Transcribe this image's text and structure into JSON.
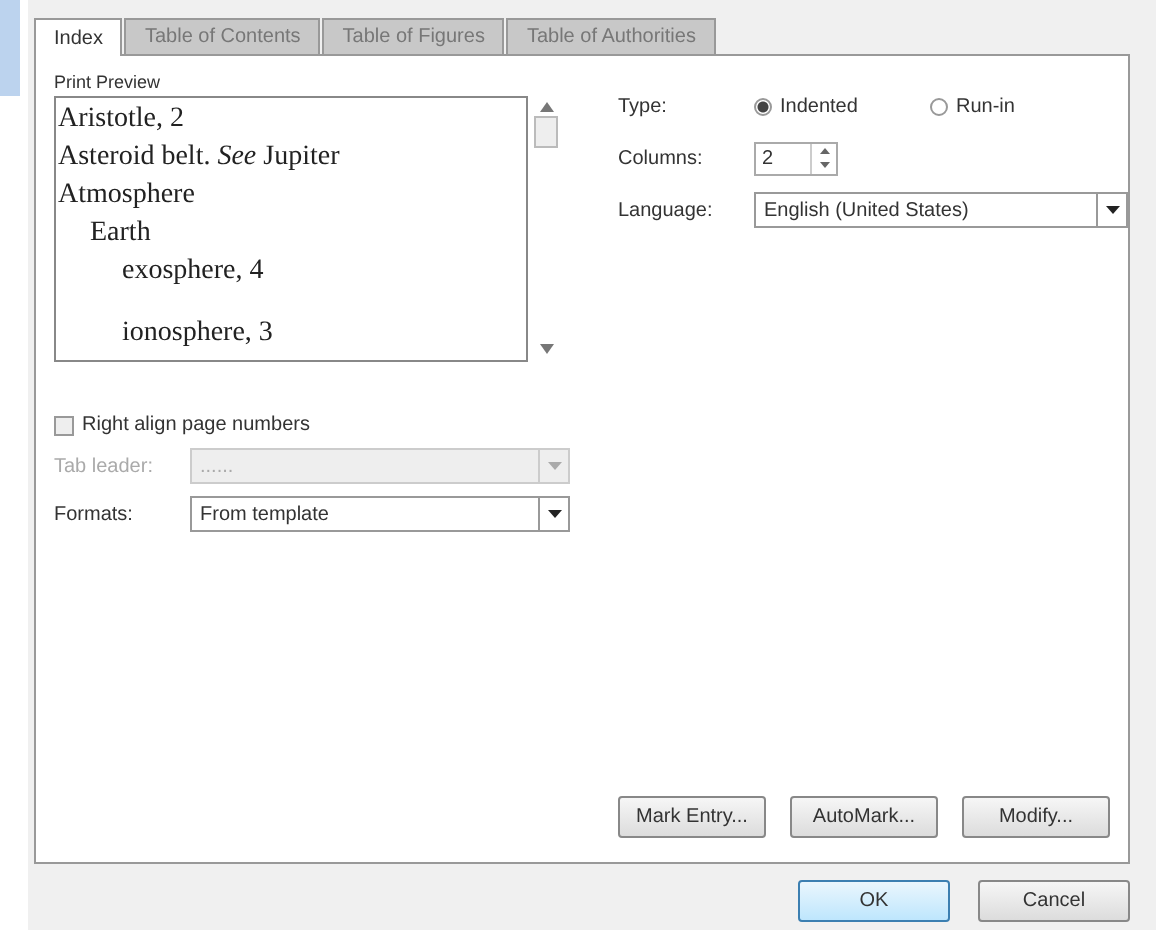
{
  "tabs": [
    {
      "label": "Index",
      "selected": true
    },
    {
      "label": "Table of Contents",
      "selected": false
    },
    {
      "label": "Table of Figures",
      "selected": false
    },
    {
      "label": "Table of Authorities",
      "selected": false
    }
  ],
  "print_preview": {
    "label": "Print Preview",
    "entries": [
      {
        "text": "Aristotle, 2"
      },
      {
        "text": "Asteroid belt. *See* Jupiter"
      },
      {
        "text": "Atmosphere",
        "children": [
          {
            "text": "Earth",
            "children": [
              {
                "text": "exosphere, 4"
              },
              {
                "text": "ionosphere, 3",
                "gap_before": true
              }
            ]
          }
        ]
      }
    ]
  },
  "type": {
    "label": "Type:",
    "options": [
      {
        "label": "Indented",
        "selected": true
      },
      {
        "label": "Run-in",
        "selected": false
      }
    ]
  },
  "columns": {
    "label": "Columns:",
    "value": "2"
  },
  "language": {
    "label": "Language:",
    "value": "English (United States)"
  },
  "right_align": {
    "label": "Right align page numbers",
    "checked": false
  },
  "tab_leader": {
    "label": "Tab leader:",
    "value": "......",
    "disabled": true
  },
  "formats": {
    "label": "Formats:",
    "value": "From template"
  },
  "panel_buttons": [
    "Mark Entry...",
    "AutoMark...",
    "Modify..."
  ],
  "dialog_buttons": [
    {
      "label": "OK",
      "default": true
    },
    {
      "label": "Cancel",
      "default": false
    }
  ]
}
